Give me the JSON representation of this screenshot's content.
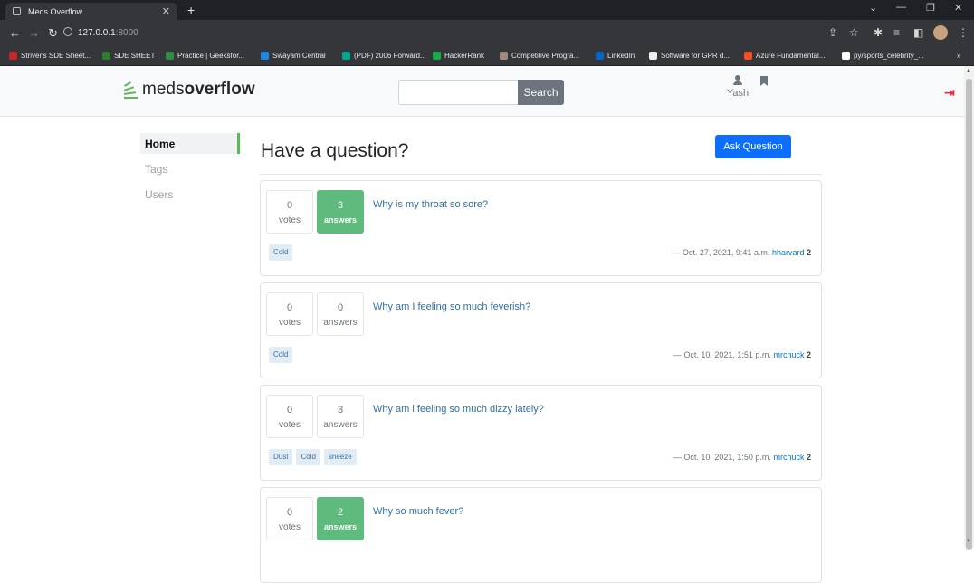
{
  "browser": {
    "tab_title": "Meds Overflow",
    "url_host": "127.0.0.1",
    "url_port": ":8000",
    "bookmarks": [
      {
        "label": "Striver's SDE Sheet...",
        "icon_color": "#c62828"
      },
      {
        "label": "SDE SHEET",
        "icon_color": "#2e7d32"
      },
      {
        "label": "Practice | Geeksfor...",
        "icon_color": "#2f8d46"
      },
      {
        "label": "Swayam Central",
        "icon_color": "#1e88e5"
      },
      {
        "label": "(PDF) 2006 Forward...",
        "icon_color": "#00a88e"
      },
      {
        "label": "HackerRank",
        "icon_color": "#1ba94c"
      },
      {
        "label": "Competitive Progra...",
        "icon_color": "#a1887f"
      },
      {
        "label": "LinkedIn",
        "icon_color": "#0a66c2"
      },
      {
        "label": "Software for GPR d...",
        "icon_color": "#eeeeee"
      },
      {
        "label": "Azure Fundamental...",
        "icon_color": "#f25022"
      },
      {
        "label": "py/sports_celebrity_...",
        "icon_color": "#ffffff"
      }
    ],
    "more_label": "»"
  },
  "navbar": {
    "brand_light": "meds",
    "brand_bold": "overflow",
    "search_placeholder": "",
    "search_button": "Search",
    "username": "Yash",
    "brand_color": "#5eb85c",
    "logout_color": "#dc3545"
  },
  "sidebar": {
    "items": [
      {
        "label": "Home"
      },
      {
        "label": "Tags"
      },
      {
        "label": "Users"
      }
    ]
  },
  "main": {
    "title": "Have a question?",
    "ask_button": "Ask Question",
    "questions": [
      {
        "votes": "0",
        "votes_label": "votes",
        "answers": "3",
        "answers_label": "answers",
        "title": "Why is my throat so sore?",
        "tags": [
          "Cold"
        ],
        "dash": "—",
        "date": "Oct. 27, 2021, 9:41 a.m.",
        "author": "hharvard",
        "reputation": "2"
      },
      {
        "votes": "0",
        "votes_label": "votes",
        "answers": "0",
        "answers_label": "answers",
        "title": "Why am I feeling so much feverish?",
        "tags": [
          "Cold"
        ],
        "dash": "—",
        "date": "Oct. 10, 2021, 1:51 p.m.",
        "author": "mrchuck",
        "reputation": "2"
      },
      {
        "votes": "0",
        "votes_label": "votes",
        "answers": "3",
        "answers_label": "answers",
        "title": "Why am i feeling so much dizzy lately?",
        "tags": [
          "Dust",
          "Cold",
          "sneeze"
        ],
        "dash": "—",
        "date": "Oct. 10, 2021, 1:50 p.m.",
        "author": "mrchuck",
        "reputation": "2"
      },
      {
        "votes": "0",
        "votes_label": "votes",
        "answers": "2",
        "answers_label": "answers",
        "title": "Why so much fever?"
      }
    ]
  }
}
